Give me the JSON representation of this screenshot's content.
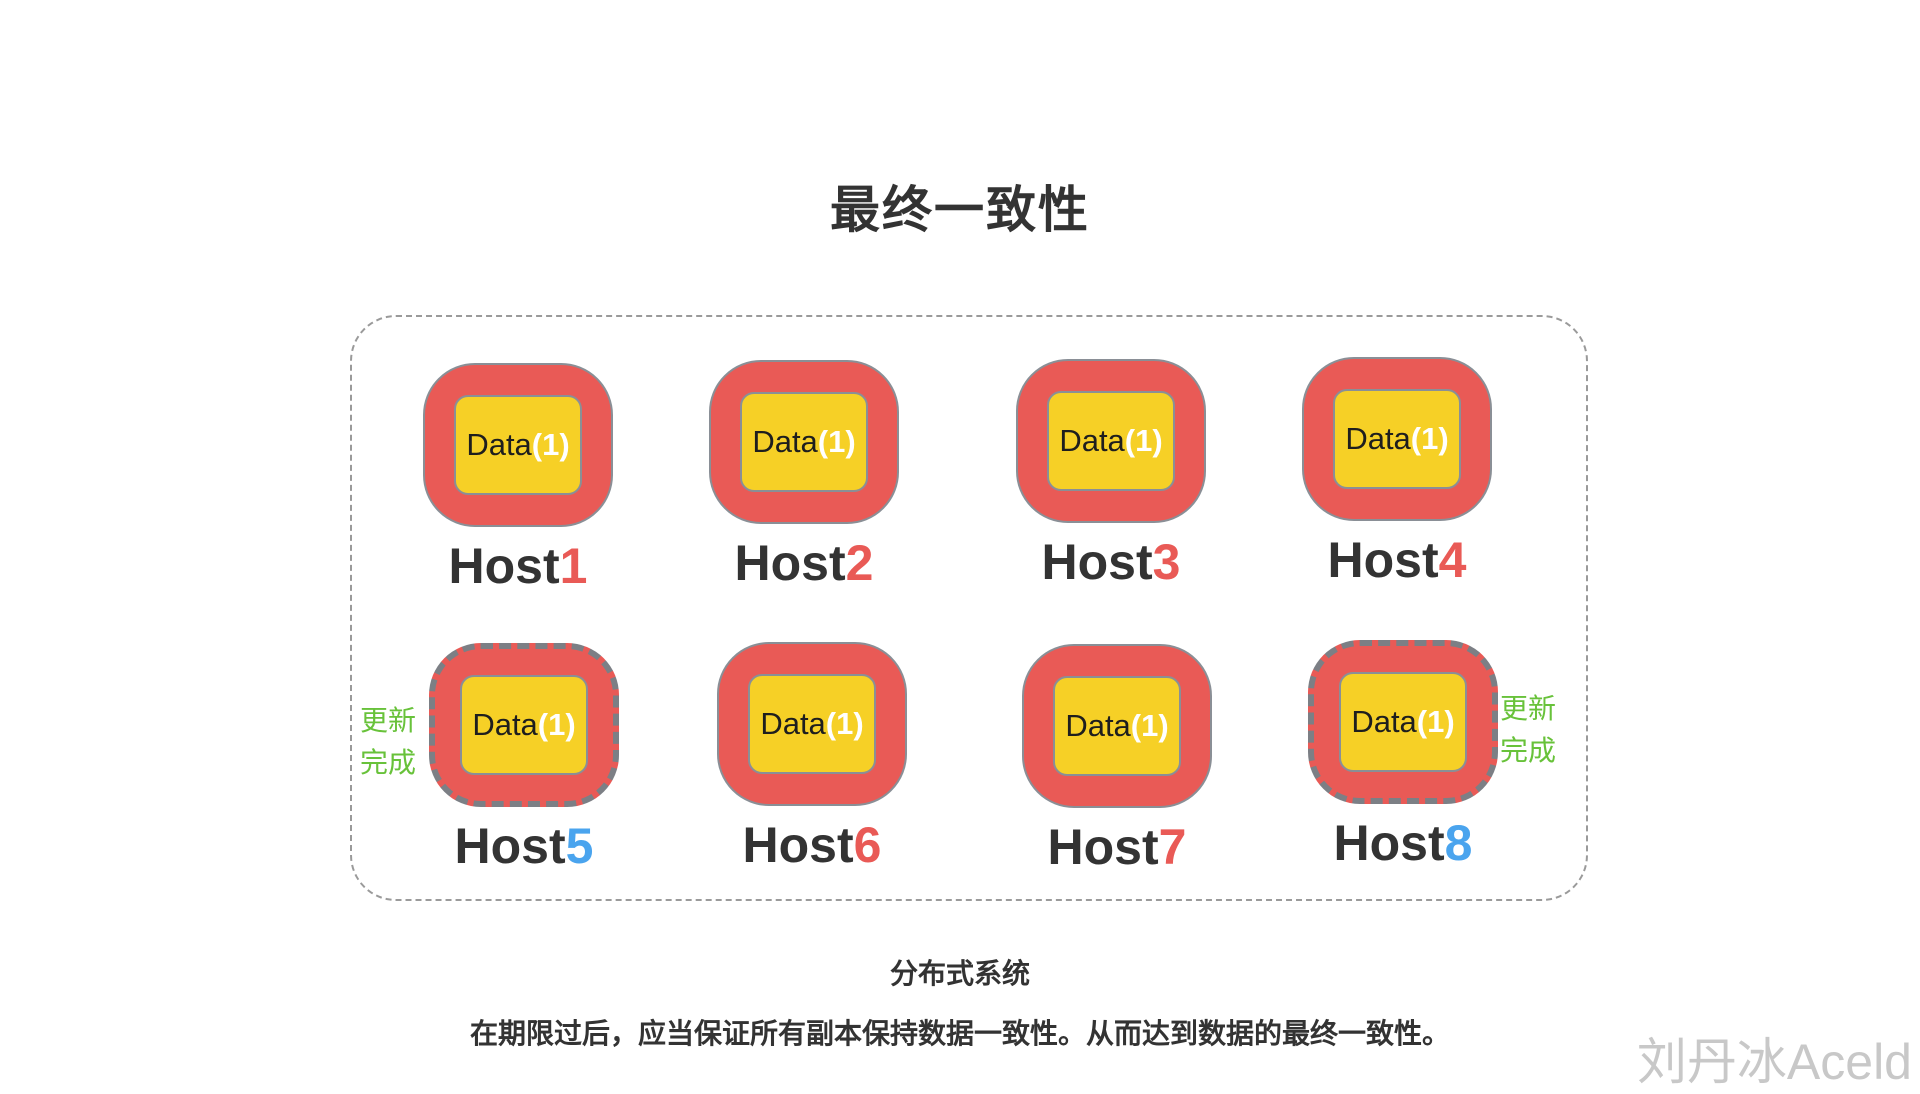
{
  "title": "最终一致性",
  "hosts": [
    {
      "label": "Host",
      "num": "1",
      "data": "Data",
      "version": "(1)"
    },
    {
      "label": "Host",
      "num": "2",
      "data": "Data",
      "version": "(1)"
    },
    {
      "label": "Host",
      "num": "3",
      "data": "Data",
      "version": "(1)"
    },
    {
      "label": "Host",
      "num": "4",
      "data": "Data",
      "version": "(1)"
    },
    {
      "label": "Host",
      "num": "5",
      "data": "Data",
      "version": "(1)"
    },
    {
      "label": "Host",
      "num": "6",
      "data": "Data",
      "version": "(1)"
    },
    {
      "label": "Host",
      "num": "7",
      "data": "Data",
      "version": "(1)"
    },
    {
      "label": "Host",
      "num": "8",
      "data": "Data",
      "version": "(1)"
    }
  ],
  "notes": {
    "left": {
      "line1": "更新",
      "line2": "完成"
    },
    "right": {
      "line1": "更新",
      "line2": "完成"
    }
  },
  "caption": "分布式系统",
  "description": "在期限过后，应当保证所有副本保持数据一致性。从而达到数据的最终一致性。",
  "watermark": "刘丹冰Aceld",
  "colors": {
    "host_box": "#e95a56",
    "data_box": "#f6d026",
    "host_number": "#e95a56",
    "updated_host_number": "#4aa4ee",
    "update_note": "#68c23a"
  }
}
